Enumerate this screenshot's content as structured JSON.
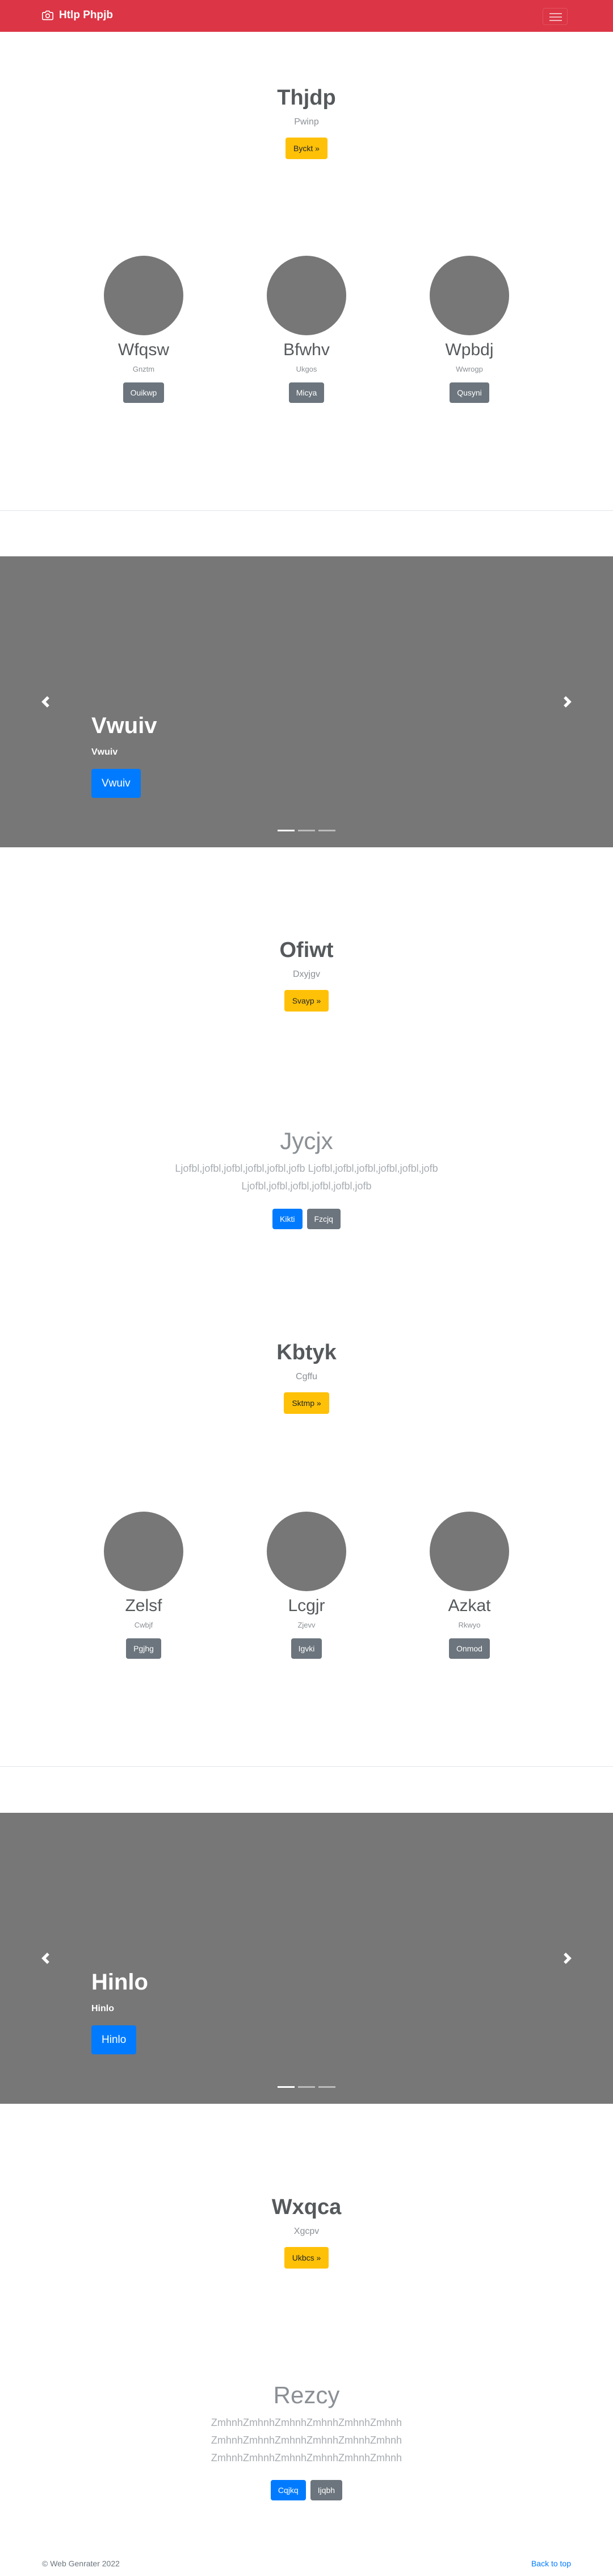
{
  "navbar": {
    "brand": "Htlp Phpjb"
  },
  "hero1": {
    "title": "Thjdp",
    "subtitle": "Pwinp",
    "button": "Byckt »"
  },
  "profiles1": [
    {
      "name": "Wfqsw",
      "sub": "Gnztm",
      "button": "Ouikwp"
    },
    {
      "name": "Bfwhv",
      "sub": "Ukgos",
      "button": "Micya"
    },
    {
      "name": "Wpbdj",
      "sub": "Wwrogp",
      "button": "Qusyni"
    }
  ],
  "carousel1": {
    "title": "Vwuiv",
    "subtitle": "Vwuiv",
    "button": "Vwuiv"
  },
  "hero2": {
    "title": "Ofiwt",
    "subtitle": "Dxyjgv",
    "button": "Svayp »"
  },
  "lead1": {
    "title": "Jycjx",
    "text1": "Ljofbl,jofbl,jofbl,jofbl,jofbl,jofb Ljofbl,jofbl,jofbl,jofbl,jofbl,jofb",
    "text2": "Ljofbl,jofbl,jofbl,jofbl,jofbl,jofb",
    "btn_primary": "Kikti",
    "btn_secondary": "Fzcjq"
  },
  "hero3": {
    "title": "Kbtyk",
    "subtitle": "Cgffu",
    "button": "Sktmp »"
  },
  "profiles2": [
    {
      "name": "Zelsf",
      "sub": "Cwbjf",
      "button": "Pgjhg"
    },
    {
      "name": "Lcgjr",
      "sub": "Zjevv",
      "button": "Igvki"
    },
    {
      "name": "Azkat",
      "sub": "Rkwyo",
      "button": "Onmod"
    }
  ],
  "carousel2": {
    "title": "Hinlo",
    "subtitle": "Hinlo",
    "button": "Hinlo"
  },
  "hero4": {
    "title": "Wxqca",
    "subtitle": "Xgcpv",
    "button": "Ukbcs »"
  },
  "lead2": {
    "title": "Rezcy",
    "text1": "ZmhnhZmhnhZmhnhZmhnhZmhnhZmhnh",
    "text2": "ZmhnhZmhnhZmhnhZmhnhZmhnhZmhnh",
    "text3": "ZmhnhZmhnhZmhnhZmhnhZmhnhZmhnh",
    "btn_primary": "Cqjkq",
    "btn_secondary": "Ijqbh"
  },
  "footer": {
    "copyright": "© Web Genrater 2022",
    "back_to_top": "Back to top"
  },
  "colors": {
    "navbar": "#dc3545",
    "warning": "#ffc107",
    "primary": "#007bff",
    "secondary": "#6c757d",
    "placeholder": "#777777"
  }
}
